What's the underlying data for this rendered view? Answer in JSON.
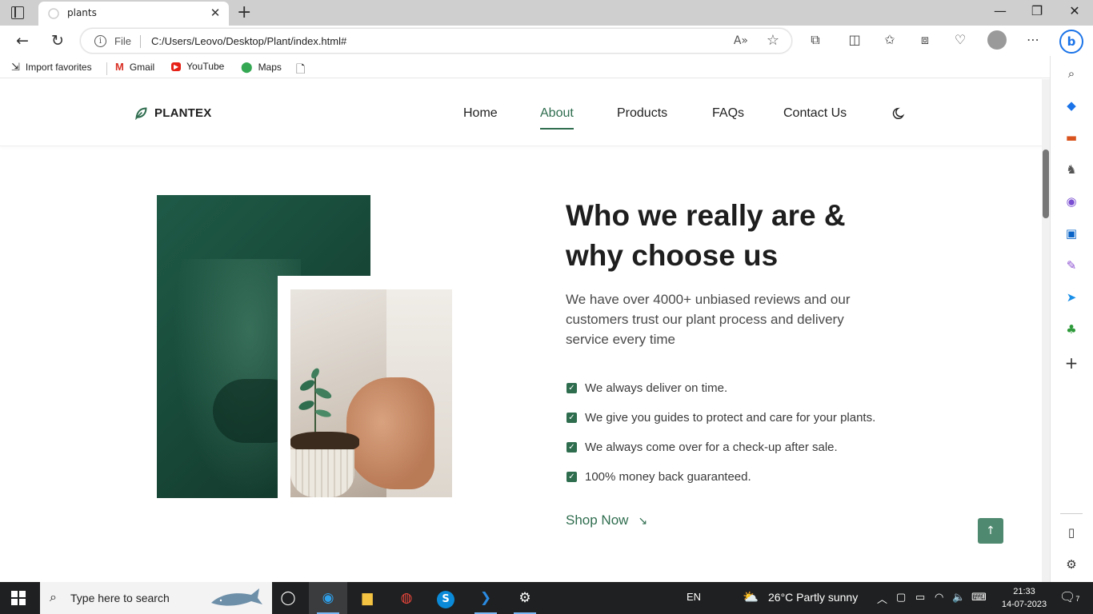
{
  "browser": {
    "tab_title": "plants",
    "address_scheme": "File",
    "address_url": "C:/Users/Leovo/Desktop/Plant/index.html#",
    "bookmarks": [
      {
        "label": "Import favorites",
        "icon": "import-icon"
      },
      {
        "label": "Gmail",
        "icon": "gmail-icon"
      },
      {
        "label": "YouTube",
        "icon": "youtube-icon"
      },
      {
        "label": "Maps",
        "icon": "maps-icon"
      }
    ]
  },
  "site": {
    "logo": "PLANTEX",
    "nav": [
      {
        "label": "Home",
        "active": false
      },
      {
        "label": "About",
        "active": true
      },
      {
        "label": "Products",
        "active": false
      },
      {
        "label": "FAQs",
        "active": false
      },
      {
        "label": "Contact Us",
        "active": false
      }
    ],
    "about": {
      "heading": "Who we really are & why choose us",
      "lead": "We have over 4000+ unbiased reviews and our customers trust our plant process and delivery service every time",
      "points": [
        "We always deliver on time.",
        "We give you guides to protect and care for your plants.",
        "We always come over for a check-up after sale.",
        "100% money back guaranteed."
      ],
      "cta": "Shop Now"
    },
    "accent_color": "#2f6d4f"
  },
  "taskbar": {
    "search_placeholder": "Type here to search",
    "language": "EN",
    "weather": "26°C  Partly sunny",
    "time": "21:33",
    "date": "14-07-2023",
    "notifications": "7"
  }
}
